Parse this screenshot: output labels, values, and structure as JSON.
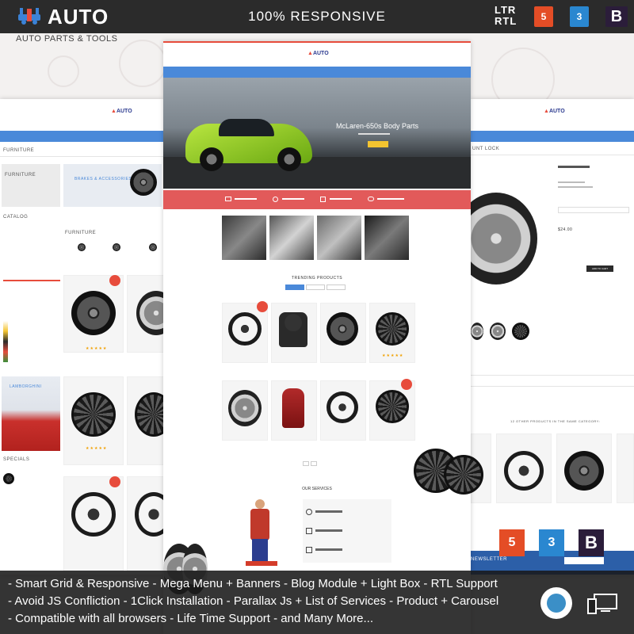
{
  "header": {
    "logo_text": "AUTO",
    "tagline": "AUTO PARTS & TOOLS",
    "center_title": "100% RESPONSIVE",
    "ltr_label": "LTR",
    "rtl_label": "RTL",
    "badge_html": "5",
    "badge_css": "3",
    "badge_bootstrap": "B"
  },
  "left_panel": {
    "breadcrumb_label": "FURNITURE",
    "sidebar_title": "FURNITURE",
    "banner_title": "BRAKES & ACCESSORIES",
    "catalog_label": "CATALOG",
    "listing_label": "FURNITURE",
    "ad_label": "LAMBORGHINI",
    "specials_label": "SPECIALS"
  },
  "center_panel": {
    "hero_title": "McLaren-650s Body Parts",
    "trending_title": "TRENDING PRODUCTS",
    "services_title": "OUR SERVICES"
  },
  "right_panel": {
    "breadcrumb_label": "UNT LOCK",
    "same_category_title": "12 OTHER PRODUCTS IN THE SAME CATEGORY:",
    "price": "$24.00",
    "add_to_cart": "ADD TO CART",
    "newsletter": "NEWSLETTER"
  },
  "overlay_badges": {
    "html": "5",
    "css": "3",
    "bootstrap": "B"
  },
  "features": [
    "-  Smart Grid & Responsive  -  Mega Menu + Banners  -  Blog Module + Light Box  -  RTL Support",
    "-  Avoid JS Confliction -  1Click Installation  -  Parallax Js + List of Services  -  Product + Carousel",
    "-  Compatible with all browsers  -  Life Time Support  -  and Many More..."
  ],
  "colors": {
    "accent_red": "#e74c3c",
    "nav_blue": "#4a89d9",
    "dark_bar": "#2b2b2b"
  }
}
